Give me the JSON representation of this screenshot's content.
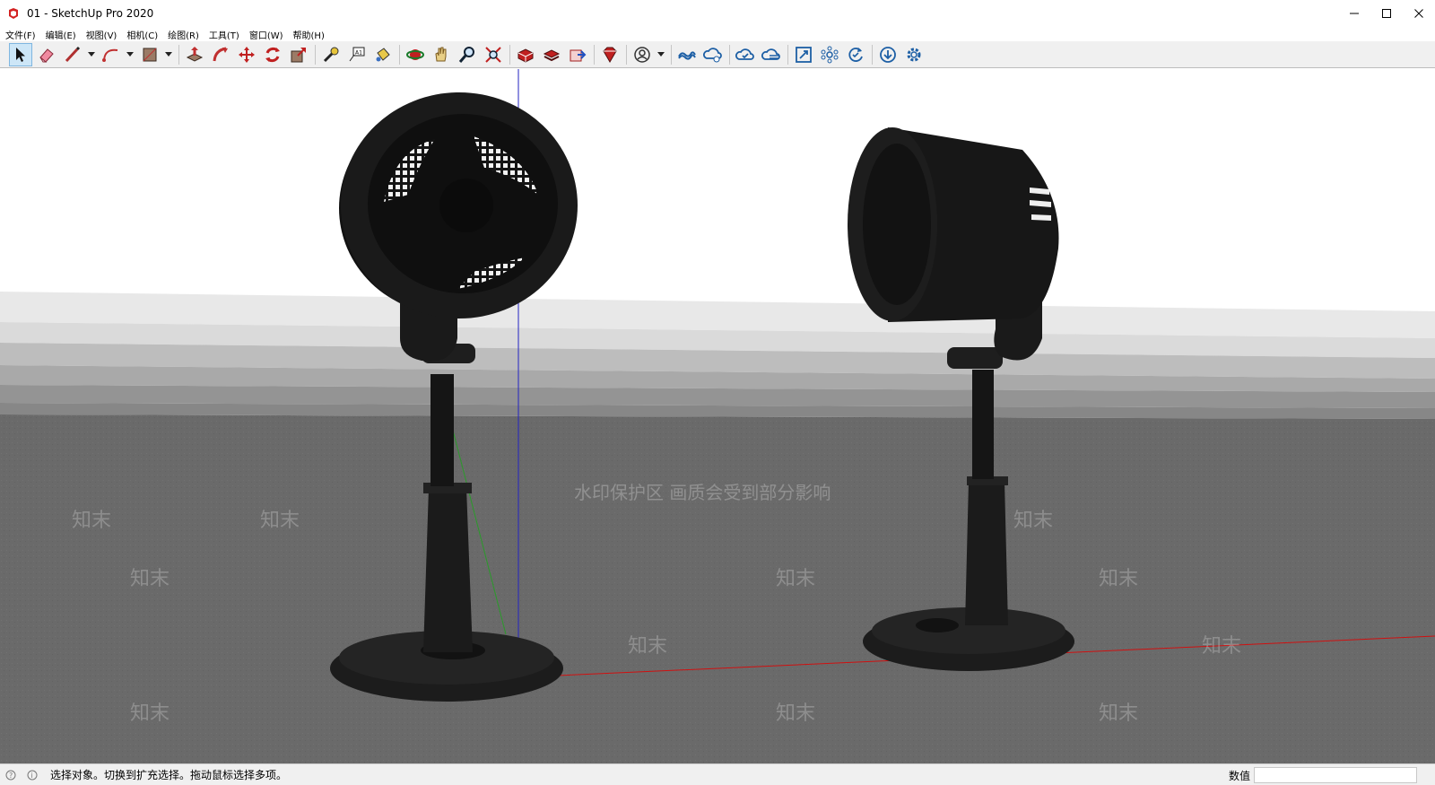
{
  "window": {
    "title": "01 - SketchUp Pro 2020"
  },
  "menu": {
    "items": [
      {
        "label": "文件(F)"
      },
      {
        "label": "编辑(E)"
      },
      {
        "label": "视图(V)"
      },
      {
        "label": "相机(C)"
      },
      {
        "label": "绘图(R)"
      },
      {
        "label": "工具(T)"
      },
      {
        "label": "窗口(W)"
      },
      {
        "label": "帮助(H)"
      }
    ]
  },
  "toolbar": {
    "tools": [
      "select-icon",
      "eraser-icon",
      "line-icon",
      "arc-icon",
      "rectangle-icon",
      "push-pull-icon",
      "follow-me-icon",
      "move-icon",
      "rotate-icon",
      "scale-icon",
      "tape-measure-icon",
      "text-icon",
      "paint-bucket-icon",
      "orbit-icon",
      "pan-icon",
      "zoom-icon",
      "zoom-extents-icon",
      "warehouse-icon",
      "extension-warehouse-icon",
      "layout-icon",
      "extension-manager-icon",
      "account-icon",
      "trimble-connect-icon",
      "connect-share-icon",
      "cloud-check-icon",
      "cloud-list-icon",
      "scene-icon",
      "components-icon",
      "update-icon",
      "download-icon",
      "settings-icon"
    ]
  },
  "viewport": {
    "watermark_banner": "水印保护区   画质会受到部分影响",
    "watermark_text": "知末",
    "colors": {
      "sky": "#ffffff",
      "ground": "#6b6b6b",
      "red_axis": "#d01010",
      "green_axis": "#2a9a2a",
      "blue_axis": "#2020c0"
    }
  },
  "status": {
    "message": "选择对象。切换到扩充选择。拖动鼠标选择多项。",
    "measure_label": "数值",
    "measure_value": ""
  }
}
